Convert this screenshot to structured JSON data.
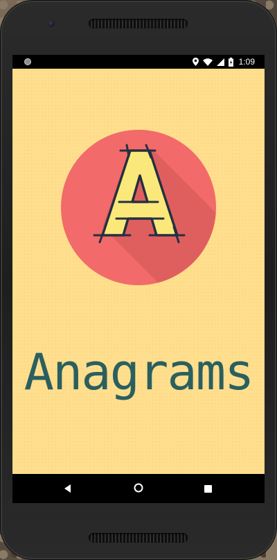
{
  "status_bar": {
    "time": "1:09",
    "icons": [
      "location-icon",
      "wifi-icon",
      "signal-icon",
      "battery-charging-icon"
    ]
  },
  "app": {
    "title": "Anagrams",
    "logo": {
      "letter": "A",
      "circle_color": "#f26a6a",
      "letter_color": "#fbe87a",
      "outline_color": "#243040"
    },
    "background_color": "#ffdf8e",
    "title_color": "#2b5f5f"
  },
  "navigation_bar": {
    "buttons": [
      "back-icon",
      "home-icon",
      "recents-icon"
    ]
  }
}
